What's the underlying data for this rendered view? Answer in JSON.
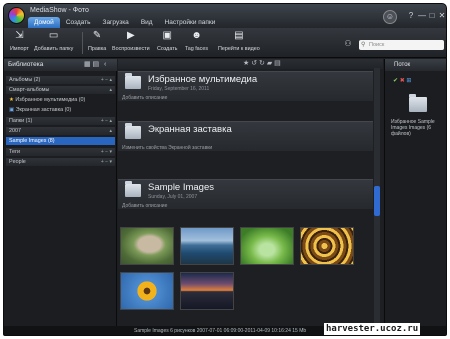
{
  "app": {
    "title": "MediaShow - Фото",
    "tabs": [
      {
        "label": "Домой",
        "active": true
      },
      {
        "label": "Создать",
        "active": false
      },
      {
        "label": "Загрузка",
        "active": false
      },
      {
        "label": "Вид",
        "active": false
      },
      {
        "label": "Настройки папки",
        "active": false
      }
    ],
    "window_buttons": [
      "?",
      "—",
      "□",
      "✕"
    ]
  },
  "toolbar": {
    "items": [
      {
        "label": "Импорт",
        "icon": "import-icon"
      },
      {
        "label": "Добавить папку",
        "icon": "add-folder-icon"
      },
      {
        "label": "Правка",
        "icon": "edit-icon"
      },
      {
        "label": "Воспроизвести",
        "icon": "play-icon"
      },
      {
        "label": "Создать",
        "icon": "create-icon"
      },
      {
        "label": "Tag faces",
        "icon": "tag-faces-icon"
      },
      {
        "label": "Перейти к видео",
        "icon": "go-to-video-icon"
      }
    ],
    "search_placeholder": "Поиск"
  },
  "sidebar": {
    "title": "Библиотека",
    "rows": [
      {
        "label": "Альбомы (2)",
        "type": "header"
      },
      {
        "label": "Смарт-альбомы",
        "type": "header"
      },
      {
        "label": "Избранное мультимедиа (0)",
        "type": "item",
        "icon": "star-icon"
      },
      {
        "label": "Экранная заставка (0)",
        "type": "item",
        "icon": "screensaver-icon"
      },
      {
        "label": "Папки (1)",
        "type": "header"
      },
      {
        "label": "2007",
        "type": "header"
      },
      {
        "label": "Sample Images (8)",
        "type": "selected"
      },
      {
        "label": "Теги",
        "type": "header"
      },
      {
        "label": "People",
        "type": "header"
      }
    ]
  },
  "sections": [
    {
      "title": "Избранное мультимедиа",
      "date": "Friday, September 16, 2011",
      "desc": "Добавить описание"
    },
    {
      "title": "Экранная заставка",
      "date": "",
      "desc": "Изменить свойства Экранной заставки"
    },
    {
      "title": "Sample Images",
      "date": "Sunday, July 01, 2007",
      "desc": "Добавить описание"
    }
  ],
  "thumbnails": [
    {
      "name": "thumb-cat"
    },
    {
      "name": "thumb-sea"
    },
    {
      "name": "thumb-bicycle"
    },
    {
      "name": "thumb-spiral"
    },
    {
      "name": "thumb-sunflower"
    },
    {
      "name": "thumb-sunset"
    }
  ],
  "right_panel": {
    "title": "Поток",
    "folder_caption": "Избранное Sample Images Images (6 файлов)"
  },
  "status": {
    "text": "Sample Images  6 рисунков  2007-07-01 06:09:00-2011-04-09 10:16:24  15 Mb"
  },
  "watermark": "harvester.ucoz.ru",
  "colors": {
    "accent": "#2966c0",
    "background": "#1c1e22"
  }
}
